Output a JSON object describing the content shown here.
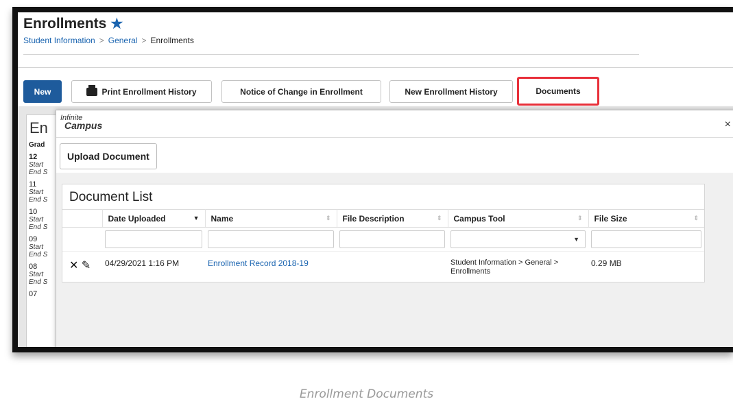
{
  "header": {
    "title": "Enrollments",
    "breadcrumb": [
      "Student Information",
      "General",
      "Enrollments"
    ]
  },
  "toolbar": {
    "new_label": "New",
    "print_label": "Print Enrollment History",
    "notice_label": "Notice of Change in Enrollment",
    "new_history_label": "New Enrollment History",
    "documents_label": "Documents"
  },
  "background": {
    "panel_title": "En",
    "grade_header": "Grad",
    "rows": [
      {
        "grade": "12",
        "start": "Start",
        "end": "End S"
      },
      {
        "grade": "11",
        "start": "Start",
        "end": "End S"
      },
      {
        "grade": "10",
        "start": "Start",
        "end": "End S"
      },
      {
        "grade": "09",
        "start": "Start",
        "end": "End S"
      },
      {
        "grade": "08",
        "start": "Start",
        "end": "End S"
      },
      {
        "grade": "07"
      }
    ]
  },
  "modal": {
    "logo_line1": "Infinite",
    "logo_line2": "Campus",
    "close": "×",
    "upload_label": "Upload Document",
    "list_title": "Document List",
    "columns": [
      "Date Uploaded",
      "Name",
      "File Description",
      "Campus Tool",
      "File Size"
    ],
    "rows": [
      {
        "date": "04/29/2021 1:16 PM",
        "name": "Enrollment Record 2018-19",
        "description": "",
        "tool": "Student Information > General > Enrollments",
        "size": "0.29 MB"
      }
    ]
  },
  "caption": "Enrollment Documents",
  "colors": {
    "accent": "#1e5b9c",
    "highlight": "#e8303a",
    "link": "#1a64b0"
  }
}
